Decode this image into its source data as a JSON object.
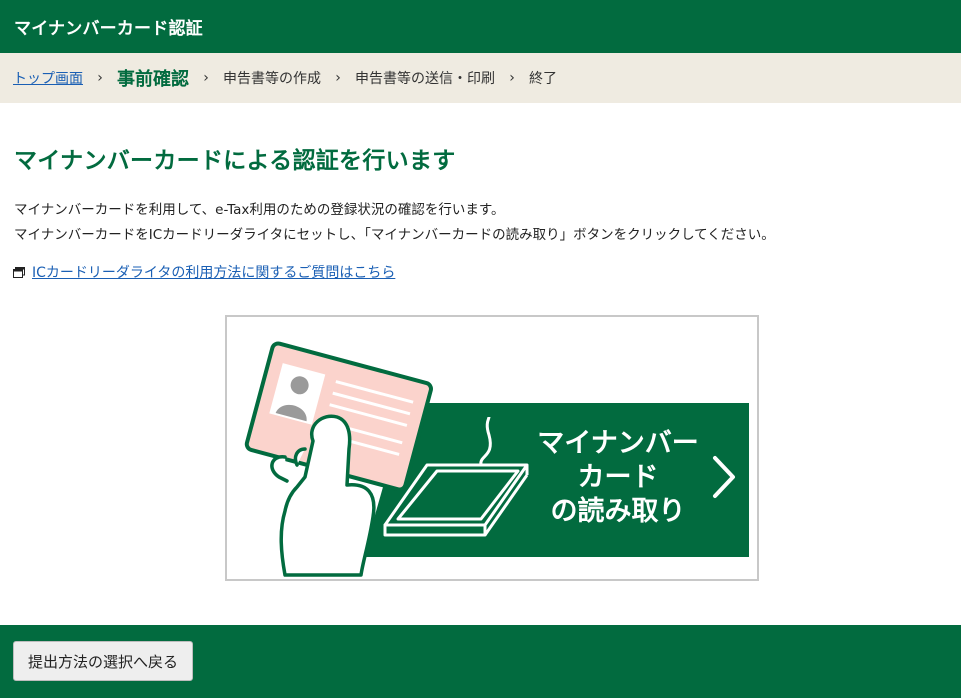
{
  "header": {
    "title": "マイナンバーカード認証"
  },
  "breadcrumb": {
    "items": [
      {
        "label": "トップ画面",
        "link": true
      },
      {
        "label": "事前確認",
        "current": true
      },
      {
        "label": "申告書等の作成"
      },
      {
        "label": "申告書等の送信・印刷"
      },
      {
        "label": "終了"
      }
    ],
    "separator": "›"
  },
  "main": {
    "title": "マイナンバーカードによる認証を行います",
    "desc_line1": "マイナンバーカードを利用して、e-Tax利用のための登録状況の確認を行います。",
    "desc_line2": "マイナンバーカードをICカードリーダライタにセットし、「マイナンバーカードの読み取り」ボタンをクリックしてください。",
    "help_link": "ICカードリーダライタの利用方法に関するご質問はこちら"
  },
  "card_button": {
    "line1": "マイナンバー",
    "line2": "カード",
    "line3": "の読み取り"
  },
  "footer": {
    "back_label": "提出方法の選択へ戻る"
  },
  "colors": {
    "brand": "#026b3f",
    "breadcrumb_bg": "#efebe1",
    "link": "#1a5fb4",
    "card_pink": "#fbd3cc"
  }
}
